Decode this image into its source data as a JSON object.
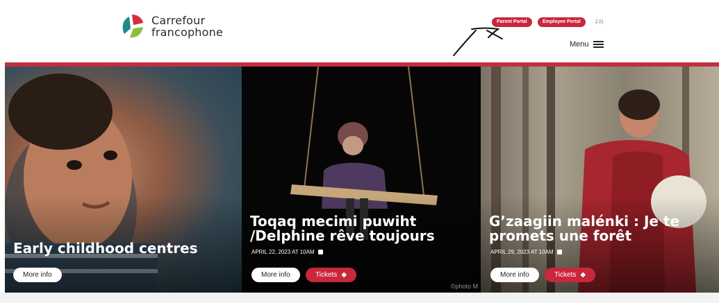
{
  "header": {
    "logo": {
      "line1": "Carrefour",
      "line2": "francophone"
    },
    "parent_portal_label": "Parent Portal",
    "employee_portal_label": "Employee Portal",
    "language_label": "FR",
    "menu_label": "Menu"
  },
  "colors": {
    "accent": "#c9273b",
    "bar": "#c22e3f"
  },
  "cards": [
    {
      "title": "Early childhood centres",
      "more_label": "More info"
    },
    {
      "title": "Toqaq mecimi puwiht /Delphine rêve toujours",
      "meta": "APRIL 22, 2023 AT 10AM",
      "more_label": "More info",
      "tickets_label": "Tickets",
      "credit": "©photo M"
    },
    {
      "title": "G’zaagiin malénki : Je te promets une forêt",
      "meta": "APRIL 29, 2023 AT 10AM",
      "more_label": "More info",
      "tickets_label": "Tickets"
    }
  ]
}
